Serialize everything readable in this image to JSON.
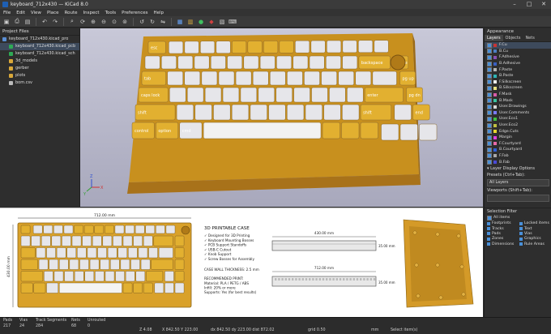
{
  "window": {
    "title": "keyboard_712x430 — KiCad 8.0",
    "controls": [
      "–",
      "□",
      "✕"
    ]
  },
  "menu": [
    "File",
    "Edit",
    "View",
    "Place",
    "Route",
    "Inspect",
    "Tools",
    "Preferences",
    "Help"
  ],
  "toolbar_icons": [
    "save-icon",
    "print-icon",
    "page-icon",
    "undo-icon",
    "redo-icon",
    "search-icon",
    "refresh-icon",
    "zoom-in-icon",
    "zoom-out-icon",
    "zoom-fit-icon",
    "zoom-selection-icon",
    "rotate-ccw-icon",
    "rotate-cw-icon",
    "flip-icon",
    "netlist-icon",
    "board-setup-icon",
    "drc-icon",
    "3d-icon",
    "footprint-editor-icon",
    "scripting-icon"
  ],
  "project": {
    "header": "Project Files",
    "items": [
      {
        "label": "keyboard_712x430.kicad_pro",
        "color": "#5a8fd6",
        "indent": 0
      },
      {
        "label": "keyboard_712x430.kicad_pcb",
        "color": "#2eaa55",
        "indent": 1
      },
      {
        "label": "keyboard_712x430.kicad_sch",
        "color": "#2eaa55",
        "indent": 1
      },
      {
        "label": "3d_models",
        "color": "#d9a83a",
        "indent": 1
      },
      {
        "label": "gerber",
        "color": "#d9a83a",
        "indent": 1
      },
      {
        "label": "plots",
        "color": "#d9a83a",
        "indent": 1
      },
      {
        "label": "bom.csv",
        "color": "#bbbbbb",
        "indent": 1
      }
    ]
  },
  "appearance": {
    "header": "Appearance",
    "tabs": [
      "Layers",
      "Objects",
      "Nets"
    ],
    "layers": [
      {
        "name": "F.Cu",
        "color": "#c83434"
      },
      {
        "name": "B.Cu",
        "color": "#4d7fc4"
      },
      {
        "name": "F.Adhesive",
        "color": "#8a50b4"
      },
      {
        "name": "B.Adhesive",
        "color": "#3a5fbf"
      },
      {
        "name": "F.Paste",
        "color": "#b4b4b4"
      },
      {
        "name": "B.Paste",
        "color": "#2fb4b4"
      },
      {
        "name": "F.Silkscreen",
        "color": "#f0f0f0"
      },
      {
        "name": "B.Silkscreen",
        "color": "#e8e080"
      },
      {
        "name": "F.Mask",
        "color": "#d85ca8"
      },
      {
        "name": "B.Mask",
        "color": "#3ac4a0"
      },
      {
        "name": "User.Drawings",
        "color": "#d8d8d8"
      },
      {
        "name": "User.Comments",
        "color": "#7a7aff"
      },
      {
        "name": "User.Eco1",
        "color": "#40c040"
      },
      {
        "name": "User.Eco2",
        "color": "#c0c040"
      },
      {
        "name": "Edge.Cuts",
        "color": "#e8d830"
      },
      {
        "name": "Margin",
        "color": "#e040e0"
      },
      {
        "name": "F.Courtyard",
        "color": "#e86aa8"
      },
      {
        "name": "B.Courtyard",
        "color": "#3060d8"
      },
      {
        "name": "F.Fab",
        "color": "#a8a8a8"
      },
      {
        "name": "B.Fab",
        "color": "#4a4ad8"
      }
    ],
    "display_options": "▾ Layer Display Options",
    "presets_label": "Presets (Ctrl+Tab):",
    "presets_value": "All Layers",
    "viewports_label": "Viewports (Shift+Tab):",
    "viewports_value": ""
  },
  "selection_filter": {
    "header": "Selection Filter",
    "all_items": "All items",
    "items": [
      "Footprints",
      "Locked items",
      "Tracks",
      "Text",
      "Pads",
      "Vias",
      "Zones",
      "Graphics",
      "Dimensions",
      "Rule Areas"
    ]
  },
  "keyboard": {
    "keys": {
      "esc": "esc",
      "tab": "tab",
      "caps": "caps lock",
      "shift_l": "shift",
      "shift_r": "shift",
      "ctrl": "control",
      "option": "option",
      "cmd": "cmd",
      "backspace": "backspace",
      "enter": "enter",
      "home": "home",
      "pgup": "pg up",
      "pgdn": "pg dn",
      "end": "end",
      "del": "del"
    }
  },
  "drawing": {
    "dim_width": "712.00 mm",
    "dim_height": "430.00 mm",
    "section_title": "3D PRINTABLE CASE",
    "features": [
      "✓ Designed for 3D Printing",
      "✓ Keyboard Mounting Bosses",
      "✓ PCB Support Standoffs",
      "✓ USB-C Cutout",
      "✓ Knob Support",
      "✓ Screw Bosses for Assembly"
    ],
    "wall": "CASE WALL THICKNESS: 2.5 mm",
    "print_title": "RECOMMENDED PRINT:",
    "print_lines": [
      "Material: PLA / PETG / ABS",
      "Infill: 20% or more",
      "Supports: Yes (for best results)"
    ],
    "side_top_dim": "430.00 mm",
    "side_right_dim": "35.00 mm",
    "front_top_dim": "712.00 mm",
    "front_right_dim": "35.00 mm"
  },
  "status": {
    "cols": [
      {
        "label": "Pads",
        "value": "217"
      },
      {
        "label": "Vias",
        "value": "24"
      },
      {
        "label": "Track Segments",
        "value": "284"
      },
      {
        "label": "Nets",
        "value": "68"
      },
      {
        "label": "Unrouted",
        "value": "0"
      }
    ],
    "z": "Z 4.08",
    "xy": "X 842.50  Y 223.00",
    "dxdy": "dx 842.50  dy 223.00  dist 872.02",
    "grid": "grid 0.50",
    "units": "mm",
    "mode": "Select item(s)"
  },
  "colors": {
    "case": "#d9a12a",
    "accent_key": "#e2b030",
    "grey_key": "#e6e6ea"
  }
}
